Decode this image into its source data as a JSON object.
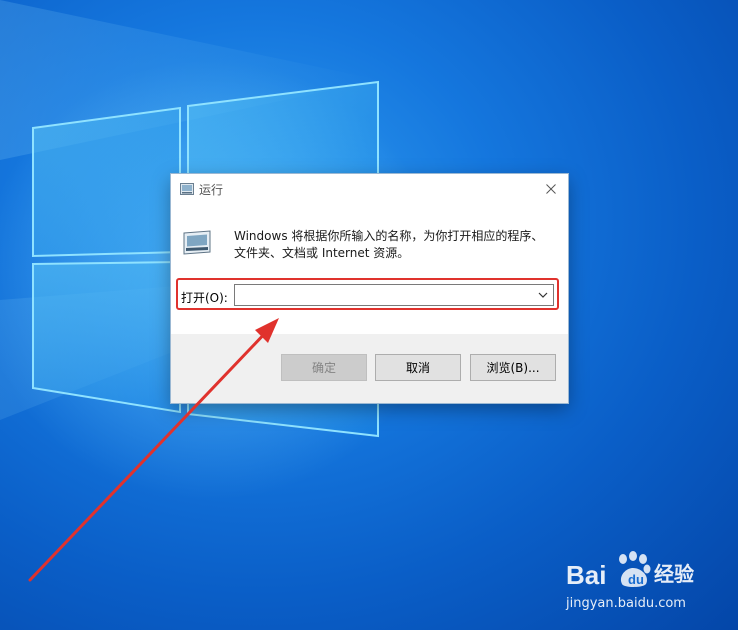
{
  "run_dialog": {
    "title": "运行",
    "description": "Windows 将根据你所输入的名称，为你打开相应的程序、文件夹、文档或 Internet 资源。",
    "open_label": "打开(O):",
    "open_value": "",
    "buttons": {
      "ok": "确定",
      "cancel": "取消",
      "browse": "浏览(B)..."
    },
    "icons": {
      "title_icon": "run-icon",
      "close": "close-icon",
      "dropdown": "chevron-down-icon"
    }
  },
  "annotation": {
    "highlight_color": "#e0322d",
    "arrow_color": "#e0322d"
  },
  "watermark": {
    "logo_text": "Bai 经验",
    "url": "jingyan.baidu.com"
  }
}
